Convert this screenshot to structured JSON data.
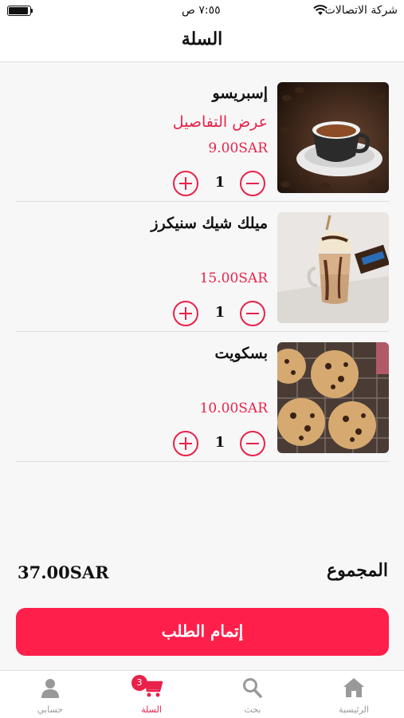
{
  "status_bar": {
    "carrier": "شركة الاتصالات",
    "time": "٧:٥٥ ص"
  },
  "header": {
    "title": "السلة"
  },
  "cart": {
    "items": [
      {
        "name": "إسبريسو",
        "details_link": "عرض التفاصيل",
        "price": "9.00SAR",
        "quantity": "1",
        "image": "espresso-cup-image"
      },
      {
        "name": "ميلك شيك سنيكرز",
        "price": "15.00SAR",
        "quantity": "1",
        "image": "snickers-milkshake-image"
      },
      {
        "name": "بسكويت",
        "price": "10.00SAR",
        "quantity": "1",
        "image": "cookies-image"
      }
    ]
  },
  "summary": {
    "total_label": "المجموع",
    "total_value": "37.00SAR"
  },
  "checkout": {
    "label": "إتمام الطلب"
  },
  "tabs": [
    {
      "label": "حسابي",
      "icon": "person-icon"
    },
    {
      "label": "السلة",
      "icon": "cart-icon",
      "badge": "3",
      "active": true
    },
    {
      "label": "بحث",
      "icon": "search-icon"
    },
    {
      "label": "الرئيسية",
      "icon": "home-icon"
    }
  ],
  "colors": {
    "accent": "#e8224a",
    "button": "#ff1f4b",
    "inactive_tab": "#999999",
    "background": "#f7f7f7"
  }
}
